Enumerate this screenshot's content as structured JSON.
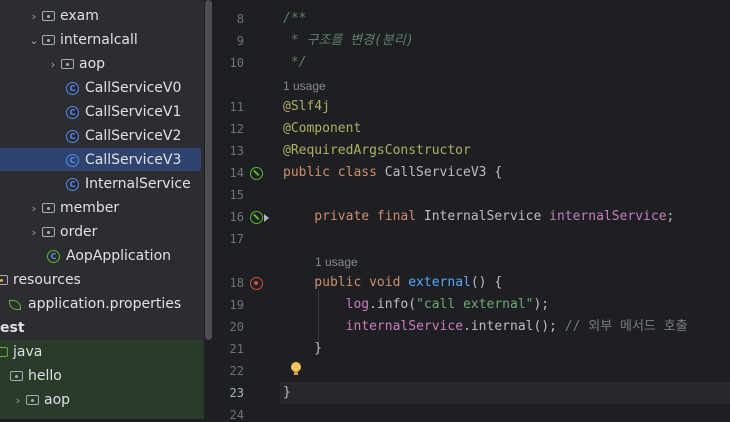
{
  "tree": [
    {
      "label": "exam",
      "kind": "folder",
      "chevron": "›",
      "indent": 1
    },
    {
      "label": "internalcall",
      "kind": "folder",
      "chevron": "⌄",
      "indent": 1
    },
    {
      "label": "aop",
      "kind": "folder",
      "chevron": "›",
      "indent": 2
    },
    {
      "label": "CallServiceV0",
      "kind": "class",
      "indent": 3
    },
    {
      "label": "CallServiceV1",
      "kind": "class",
      "indent": 3
    },
    {
      "label": "CallServiceV2",
      "kind": "class",
      "indent": 3
    },
    {
      "label": "CallServiceV3",
      "kind": "class",
      "indent": 3,
      "selected": true
    },
    {
      "label": "InternalService",
      "kind": "class",
      "indent": 3
    },
    {
      "label": "member",
      "kind": "folder",
      "chevron": "›",
      "indent": 1
    },
    {
      "label": "order",
      "kind": "folder",
      "chevron": "›",
      "indent": 1
    },
    {
      "label": "AopApplication",
      "kind": "springclass",
      "indent": 2
    },
    {
      "label": "resources",
      "kind": "resfolder",
      "indent": 0
    },
    {
      "label": "application.properties",
      "kind": "leaf",
      "indent": 0
    },
    {
      "label": "est",
      "kind": "text",
      "indent": 0
    },
    {
      "label": "java",
      "kind": "folder",
      "indent": 0
    },
    {
      "label": "hello",
      "kind": "folder",
      "indent": 0
    },
    {
      "label": "aop",
      "kind": "folder",
      "chevron": "›",
      "indent": 1
    }
  ],
  "gutter_numbers": [
    "8",
    "9",
    "10",
    "11",
    "12",
    "13",
    "14",
    "15",
    "16",
    "17",
    "18",
    "19",
    "20",
    "21",
    "22",
    "23",
    "24"
  ],
  "usage_hint_1": "1 usage",
  "usage_hint_2": "1 usage",
  "code": {
    "l8": "/**",
    "l9": " * 구조를 변경(분리)",
    "l10": " */",
    "l11": "@Slf4j",
    "l12": "@Component",
    "l13": "@RequiredArgsConstructor",
    "l14_kw": "public class ",
    "l14_name": "CallServiceV3 {",
    "l16_kw": "    private final ",
    "l16_type": "InternalService ",
    "l16_field": "internalService",
    "l16_end": ";",
    "l18_kw": "    public void ",
    "l18_mth": "external",
    "l18_end": "() {",
    "l19_pre": "        ",
    "l19_log": "log",
    "l19_mid": ".info(",
    "l19_str": "\"call external\"",
    "l19_end": ");",
    "l20_pre": "        ",
    "l20_field": "internalService",
    "l20_mid": ".internal(); ",
    "l20_cmt": "// 외부 메서드 호출",
    "l21": "    }",
    "l23": "}"
  }
}
